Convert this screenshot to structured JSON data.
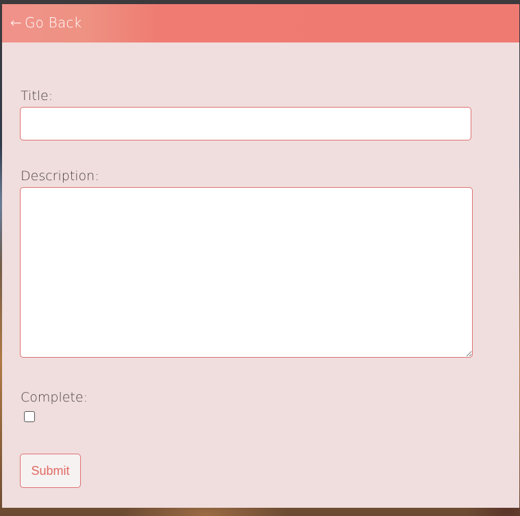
{
  "header": {
    "back_label": "Go Back",
    "back_arrow": "←",
    "back_icon": "arrow-left-icon"
  },
  "form": {
    "title_label": "Title:",
    "title_value": "",
    "description_label": "Description:",
    "description_value": "",
    "complete_label": "Complete:",
    "complete_checked": false,
    "submit_label": "Submit"
  },
  "colors": {
    "accent": "#ef7a72",
    "card_bg": "#f0dede",
    "border": "#e07070",
    "submit_text": "#e06a62"
  }
}
